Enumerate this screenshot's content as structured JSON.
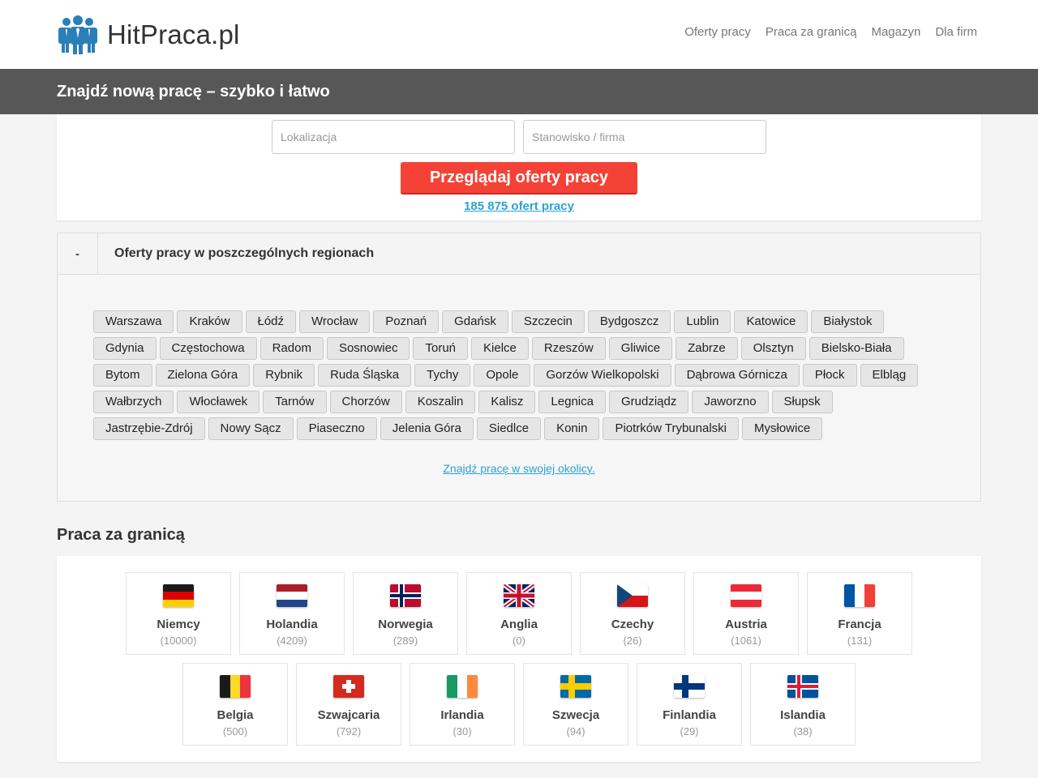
{
  "header": {
    "logo_text": "HitPraca.pl",
    "nav": [
      "Oferty pracy",
      "Praca za granicą",
      "Magazyn",
      "Dla firm"
    ]
  },
  "banner": {
    "title": "Znajdź nową pracę – szybko i łatwo"
  },
  "search": {
    "location_placeholder": "Lokalizacja",
    "position_placeholder": "Stanowisko / firma",
    "button_label": "Przeglądaj oferty pracy",
    "offers_count": "185 875 ofert pracy"
  },
  "regions": {
    "toggle": "-",
    "title": "Oferty pracy w poszczególnych regionach",
    "cities": [
      "Warszawa",
      "Kraków",
      "Łódź",
      "Wrocław",
      "Poznań",
      "Gdańsk",
      "Szczecin",
      "Bydgoszcz",
      "Lublin",
      "Katowice",
      "Białystok",
      "Gdynia",
      "Częstochowa",
      "Radom",
      "Sosnowiec",
      "Toruń",
      "Kielce",
      "Rzeszów",
      "Gliwice",
      "Zabrze",
      "Olsztyn",
      "Bielsko-Biała",
      "Bytom",
      "Zielona Góra",
      "Rybnik",
      "Ruda Śląska",
      "Tychy",
      "Opole",
      "Gorzów Wielkopolski",
      "Dąbrowa Górnicza",
      "Płock",
      "Elbląg",
      "Wałbrzych",
      "Włocławek",
      "Tarnów",
      "Chorzów",
      "Koszalin",
      "Kalisz",
      "Legnica",
      "Grudziądz",
      "Jaworzno",
      "Słupsk",
      "Jastrzębie-Zdrój",
      "Nowy Sącz",
      "Piaseczno",
      "Jelenia Góra",
      "Siedlce",
      "Konin",
      "Piotrków Trybunalski",
      "Mysłowice"
    ],
    "nearby_link": "Znajdź pracę w swojej okolicy."
  },
  "abroad": {
    "title": "Praca za granicą",
    "countries": [
      {
        "name": "Niemcy",
        "count": "(10000)",
        "flag": "de"
      },
      {
        "name": "Holandia",
        "count": "(4209)",
        "flag": "nl"
      },
      {
        "name": "Norwegia",
        "count": "(289)",
        "flag": "no"
      },
      {
        "name": "Anglia",
        "count": "(0)",
        "flag": "gb"
      },
      {
        "name": "Czechy",
        "count": "(26)",
        "flag": "cz"
      },
      {
        "name": "Austria",
        "count": "(1061)",
        "flag": "at"
      },
      {
        "name": "Francja",
        "count": "(131)",
        "flag": "fr"
      },
      {
        "name": "Belgia",
        "count": "(500)",
        "flag": "be"
      },
      {
        "name": "Szwajcaria",
        "count": "(792)",
        "flag": "ch"
      },
      {
        "name": "Irlandia",
        "count": "(30)",
        "flag": "ie"
      },
      {
        "name": "Szwecja",
        "count": "(94)",
        "flag": "se"
      },
      {
        "name": "Finlandia",
        "count": "(29)",
        "flag": "fi"
      },
      {
        "name": "Islandia",
        "count": "(38)",
        "flag": "is"
      }
    ]
  },
  "colors": {
    "accent_button": "#f44336",
    "link": "#29a3d6",
    "banner": "#575757",
    "logo_blue": "#2a7fb8"
  }
}
